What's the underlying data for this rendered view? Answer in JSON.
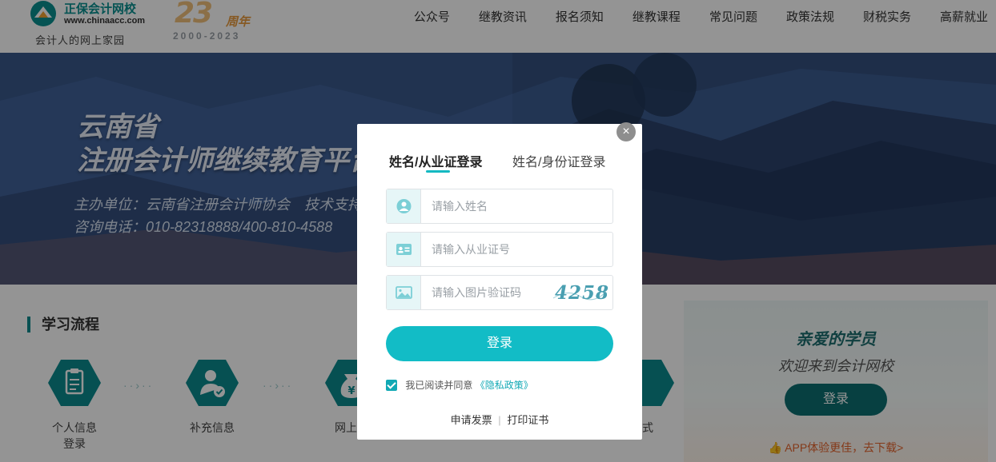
{
  "header": {
    "logo": {
      "brand": "正保会计网校",
      "url": "www.chinaacc.com",
      "slogan": "会计人的网上家园"
    },
    "anniversary": {
      "number": "23",
      "unit": "周年",
      "years": "2000-2023"
    },
    "nav": [
      "公众号",
      "继教资讯",
      "报名须知",
      "继教课程",
      "常见问题",
      "政策法规",
      "财税实务",
      "高薪就业"
    ]
  },
  "banner": {
    "title_line1": "云南省",
    "title_line2": "注册会计师继续教育平台",
    "organizer": "主办单位：云南省注册会计师协会　技术支持：正保会计网校",
    "hotline": "咨询电话：010-82318888/400-810-4588"
  },
  "process": {
    "title": "学习流程",
    "steps": [
      {
        "label_line1": "个人信息",
        "label_line2": "登录",
        "icon": "clipboard-icon"
      },
      {
        "label_line1": "补充信息",
        "label_line2": "",
        "icon": "user-check-icon"
      },
      {
        "label_line1": "网上学",
        "label_line2": "",
        "icon": "yuan-bag-icon"
      },
      {
        "label_line1": "式",
        "label_line2": "",
        "icon": "exam-icon"
      }
    ],
    "dots": "··›··"
  },
  "sidebar": {
    "title": "亲爱的学员",
    "subtitle": "欢迎来到会计网校",
    "login_label": "登录",
    "app_text": "APP体验更佳，去下载>"
  },
  "modal": {
    "tabs": [
      "姓名/从业证登录",
      "姓名/身份证登录"
    ],
    "active_tab": 0,
    "fields": {
      "name_placeholder": "请输入姓名",
      "cert_placeholder": "请输入从业证号",
      "captcha_placeholder": "请输入图片验证码",
      "captcha_code": "4258"
    },
    "login_label": "登录",
    "agree_text": "我已阅读并同意",
    "policy_text": "《隐私政策》",
    "footer": {
      "invoice": "申请发票",
      "separator": "|",
      "print_cert": "打印证书"
    },
    "close_symbol": "×"
  },
  "colors": {
    "accent": "#12bcc6",
    "brand_dark": "#0d6e70",
    "app_orange": "#e4632c"
  }
}
